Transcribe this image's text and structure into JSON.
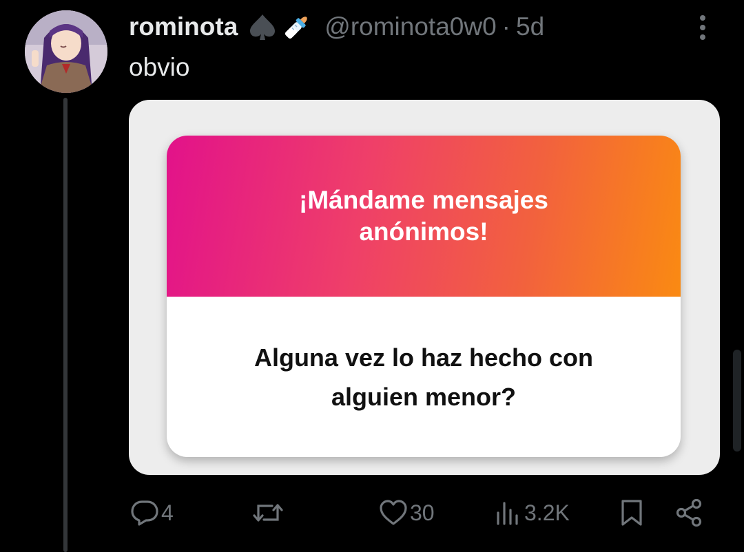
{
  "tweet": {
    "display_name": "rominota",
    "name_emojis": [
      "spade-suit-emoji",
      "baby-bottle-emoji"
    ],
    "handle": "@rominota0w0",
    "separator": "·",
    "time": "5d",
    "text": "obvio"
  },
  "media": {
    "card_title": "¡Mándame mensajes anónimos!",
    "card_question": "Alguna vez lo haz hecho con alguien menor?"
  },
  "actions": {
    "replies": "4",
    "retweets": "",
    "likes": "30",
    "views": "3.2K"
  },
  "icons": [
    "more-icon",
    "reply-icon",
    "retweet-icon",
    "like-icon",
    "views-icon",
    "bookmark-icon",
    "share-icon"
  ],
  "colors": {
    "background": "#000000",
    "text_primary": "#e7e9ea",
    "text_secondary": "#71767b",
    "gradient_start": "#e2128a",
    "gradient_end": "#fa8a12"
  }
}
